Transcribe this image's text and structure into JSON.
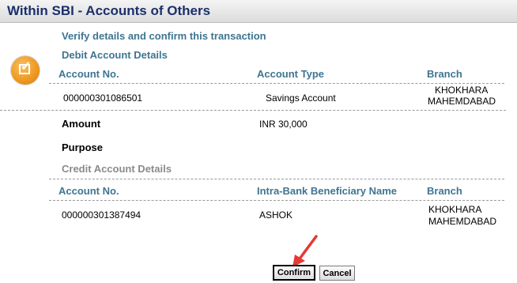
{
  "header": {
    "title": "Within SBI - Accounts of Others"
  },
  "verify_text": "Verify details and confirm this transaction",
  "debit": {
    "section_label": "Debit Account Details",
    "headers": {
      "account_no": "Account No.",
      "account_type": "Account Type",
      "branch": "Branch"
    },
    "account_no": "000000301086501",
    "account_type": "Savings Account",
    "branch_line1": "KHOKHARA",
    "branch_line2": "MAHEMDABAD"
  },
  "amount": {
    "label": "Amount",
    "value": "INR 30,000"
  },
  "purpose": {
    "label": "Purpose"
  },
  "credit": {
    "section_label": "Credit Account Details",
    "headers": {
      "account_no": "Account No.",
      "beneficiary": "Intra-Bank Beneficiary Name",
      "branch": "Branch"
    },
    "account_no": "000000301387494",
    "beneficiary": "ASHOK",
    "branch_line1": "KHOKHARA",
    "branch_line2": "MAHEMDABAD"
  },
  "buttons": {
    "confirm": "Confirm",
    "cancel": "Cancel"
  },
  "colors": {
    "title": "#1b2f6b",
    "heading": "#3e7592",
    "icon": "#ef9a22",
    "arrow": "#e53935"
  },
  "icons": {
    "status": "check-icon",
    "pointer": "arrow-icon"
  }
}
